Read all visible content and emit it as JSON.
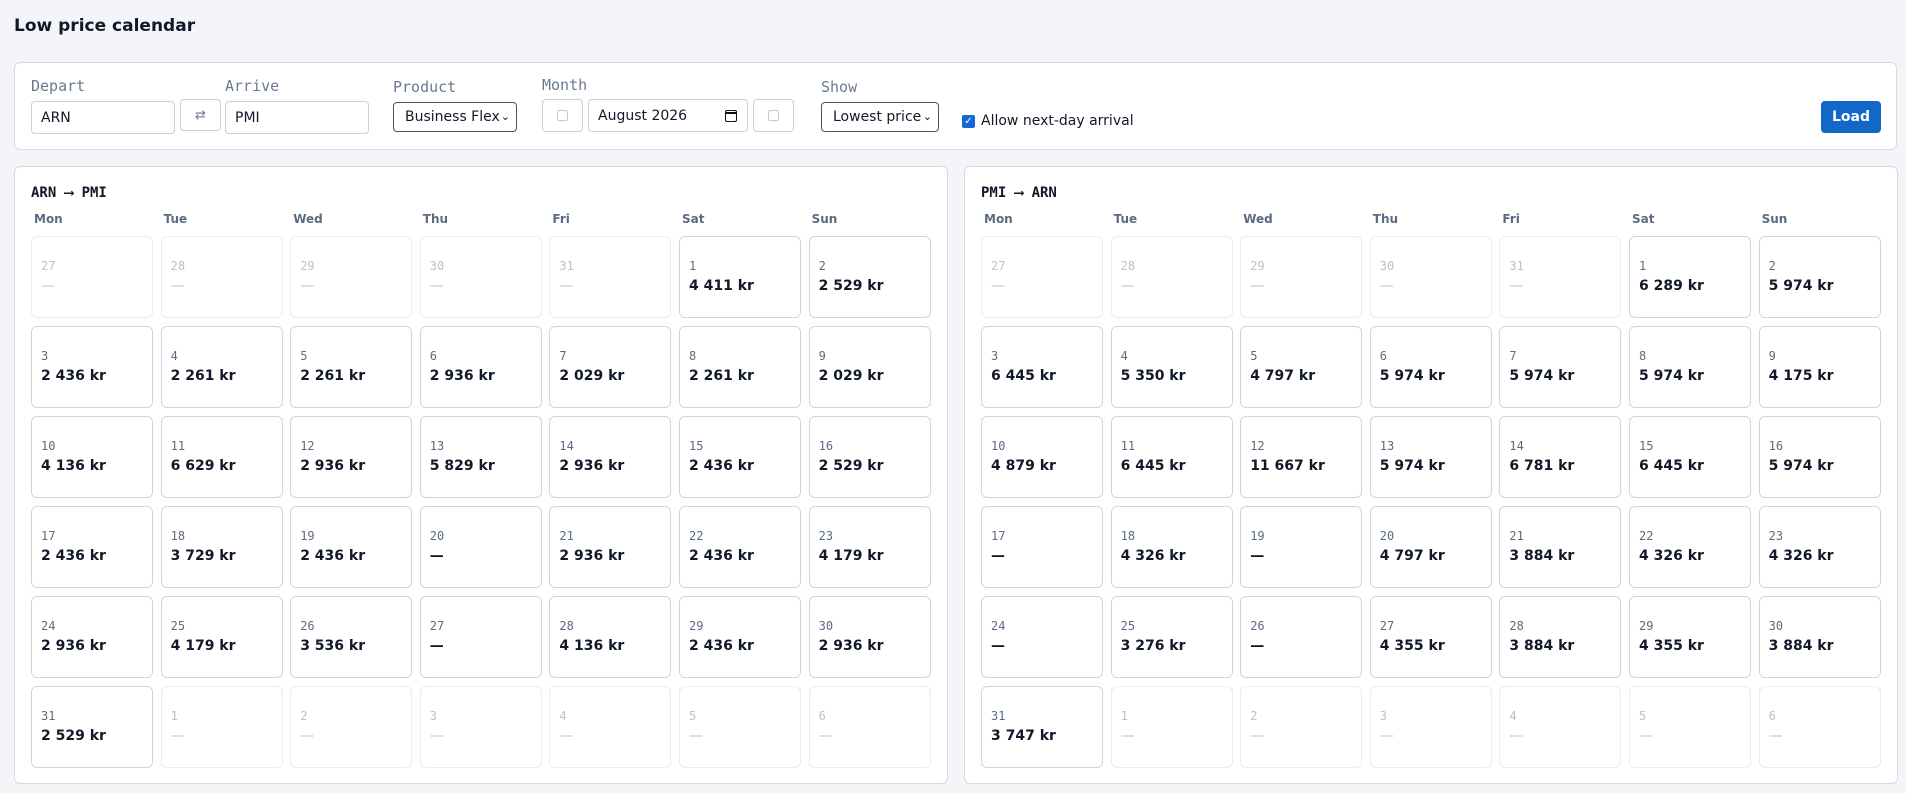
{
  "page": {
    "title": "Low price calendar"
  },
  "filters": {
    "depart_label": "Depart",
    "depart_value": "ARN",
    "swap_icon": "swap-arrows-icon",
    "arrive_label": "Arrive",
    "arrive_value": "PMI",
    "product_label": "Product",
    "product_value": "Business Flex",
    "month_label": "Month",
    "month_value": "August 2026",
    "show_label": "Show",
    "show_value": "Lowest price",
    "next_day_label": "Allow next-day arrival",
    "next_day_checked": true,
    "load_label": "Load"
  },
  "weekdays": [
    "Mon",
    "Tue",
    "Wed",
    "Thu",
    "Fri",
    "Sat",
    "Sun"
  ],
  "outbound": {
    "route": "ARN ⟶ PMI",
    "days": [
      {
        "d": "27",
        "p": "—",
        "out": true
      },
      {
        "d": "28",
        "p": "—",
        "out": true
      },
      {
        "d": "29",
        "p": "—",
        "out": true
      },
      {
        "d": "30",
        "p": "—",
        "out": true
      },
      {
        "d": "31",
        "p": "—",
        "out": true
      },
      {
        "d": "1",
        "p": "4 411 kr"
      },
      {
        "d": "2",
        "p": "2 529 kr"
      },
      {
        "d": "3",
        "p": "2 436 kr"
      },
      {
        "d": "4",
        "p": "2 261 kr"
      },
      {
        "d": "5",
        "p": "2 261 kr"
      },
      {
        "d": "6",
        "p": "2 936 kr"
      },
      {
        "d": "7",
        "p": "2 029 kr"
      },
      {
        "d": "8",
        "p": "2 261 kr"
      },
      {
        "d": "9",
        "p": "2 029 kr"
      },
      {
        "d": "10",
        "p": "4 136 kr"
      },
      {
        "d": "11",
        "p": "6 629 kr"
      },
      {
        "d": "12",
        "p": "2 936 kr"
      },
      {
        "d": "13",
        "p": "5 829 kr"
      },
      {
        "d": "14",
        "p": "2 936 kr"
      },
      {
        "d": "15",
        "p": "2 436 kr"
      },
      {
        "d": "16",
        "p": "2 529 kr"
      },
      {
        "d": "17",
        "p": "2 436 kr"
      },
      {
        "d": "18",
        "p": "3 729 kr"
      },
      {
        "d": "19",
        "p": "2 436 kr"
      },
      {
        "d": "20",
        "p": "—"
      },
      {
        "d": "21",
        "p": "2 936 kr"
      },
      {
        "d": "22",
        "p": "2 436 kr"
      },
      {
        "d": "23",
        "p": "4 179 kr"
      },
      {
        "d": "24",
        "p": "2 936 kr"
      },
      {
        "d": "25",
        "p": "4 179 kr"
      },
      {
        "d": "26",
        "p": "3 536 kr"
      },
      {
        "d": "27",
        "p": "—"
      },
      {
        "d": "28",
        "p": "4 136 kr"
      },
      {
        "d": "29",
        "p": "2 436 kr"
      },
      {
        "d": "30",
        "p": "2 936 kr"
      },
      {
        "d": "31",
        "p": "2 529 kr"
      },
      {
        "d": "1",
        "p": "—",
        "out": true
      },
      {
        "d": "2",
        "p": "—",
        "out": true
      },
      {
        "d": "3",
        "p": "—",
        "out": true
      },
      {
        "d": "4",
        "p": "—",
        "out": true
      },
      {
        "d": "5",
        "p": "—",
        "out": true
      },
      {
        "d": "6",
        "p": "—",
        "out": true
      }
    ]
  },
  "inbound": {
    "route": "PMI ⟶ ARN",
    "days": [
      {
        "d": "27",
        "p": "—",
        "out": true
      },
      {
        "d": "28",
        "p": "—",
        "out": true
      },
      {
        "d": "29",
        "p": "—",
        "out": true
      },
      {
        "d": "30",
        "p": "—",
        "out": true
      },
      {
        "d": "31",
        "p": "—",
        "out": true
      },
      {
        "d": "1",
        "p": "6 289 kr"
      },
      {
        "d": "2",
        "p": "5 974 kr"
      },
      {
        "d": "3",
        "p": "6 445 kr"
      },
      {
        "d": "4",
        "p": "5 350 kr"
      },
      {
        "d": "5",
        "p": "4 797 kr"
      },
      {
        "d": "6",
        "p": "5 974 kr"
      },
      {
        "d": "7",
        "p": "5 974 kr"
      },
      {
        "d": "8",
        "p": "5 974 kr"
      },
      {
        "d": "9",
        "p": "4 175 kr"
      },
      {
        "d": "10",
        "p": "4 879 kr"
      },
      {
        "d": "11",
        "p": "6 445 kr"
      },
      {
        "d": "12",
        "p": "11 667 kr"
      },
      {
        "d": "13",
        "p": "5 974 kr"
      },
      {
        "d": "14",
        "p": "6 781 kr"
      },
      {
        "d": "15",
        "p": "6 445 kr"
      },
      {
        "d": "16",
        "p": "5 974 kr"
      },
      {
        "d": "17",
        "p": "—"
      },
      {
        "d": "18",
        "p": "4 326 kr"
      },
      {
        "d": "19",
        "p": "—"
      },
      {
        "d": "20",
        "p": "4 797 kr"
      },
      {
        "d": "21",
        "p": "3 884 kr"
      },
      {
        "d": "22",
        "p": "4 326 kr"
      },
      {
        "d": "23",
        "p": "4 326 kr"
      },
      {
        "d": "24",
        "p": "—"
      },
      {
        "d": "25",
        "p": "3 276 kr"
      },
      {
        "d": "26",
        "p": "—"
      },
      {
        "d": "27",
        "p": "4 355 kr"
      },
      {
        "d": "28",
        "p": "3 884 kr"
      },
      {
        "d": "29",
        "p": "4 355 kr"
      },
      {
        "d": "30",
        "p": "3 884 kr"
      },
      {
        "d": "31",
        "p": "3 747 kr"
      },
      {
        "d": "1",
        "p": "—",
        "out": true
      },
      {
        "d": "2",
        "p": "—",
        "out": true
      },
      {
        "d": "3",
        "p": "—",
        "out": true
      },
      {
        "d": "4",
        "p": "—",
        "out": true
      },
      {
        "d": "5",
        "p": "—",
        "out": true
      },
      {
        "d": "6",
        "p": "—",
        "out": true
      }
    ]
  }
}
